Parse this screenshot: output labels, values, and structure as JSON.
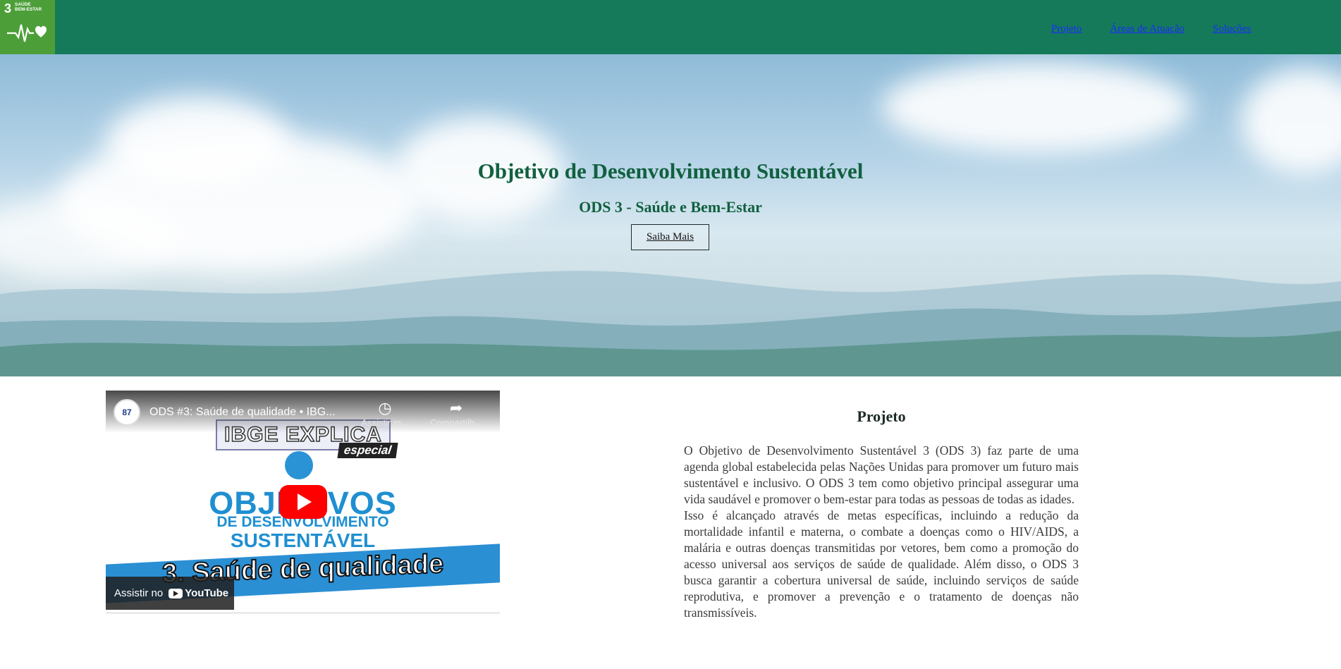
{
  "header": {
    "logo": {
      "number": "3",
      "label_line1": "SAÚDE",
      "label_line2": "BEM-ESTAR"
    },
    "nav": [
      "Projeto",
      "Áreas de Atuação",
      "Soluções"
    ]
  },
  "hero": {
    "title": "Objetivo de Desenvolvimento Sustentável",
    "subtitle": "ODS 3 - Saúde e Bem-Estar",
    "button_label": "Saiba Mais"
  },
  "video": {
    "channel_badge": "87",
    "title": "ODS #3: Saúde de qualidade • IBG...",
    "actions": [
      "Assistir m...",
      "Compartilh..."
    ],
    "thumb_banner": "IBGE EXPLICA",
    "thumb_tag": "especial",
    "thumb_line1": "OBJETIVOS",
    "thumb_line2": "DE DESENVOLVIMENTO",
    "thumb_line3": "SUSTENTÁVEL",
    "thumb_caption": "3. Saúde de qualidade",
    "watch_on": "Assistir no",
    "youtube": "YouTube"
  },
  "projeto": {
    "title": "Projeto",
    "paragraph1": "O Objetivo de Desenvolvimento Sustentável 3 (ODS 3) faz parte de uma agenda global estabelecida pelas Nações Unidas para promover um futuro mais sustentável e inclusivo. O ODS 3 tem como objetivo principal assegurar uma vida saudável e promover o bem-estar para todas as pessoas de todas as idades.",
    "paragraph2": "Isso é alcançado através de metas específicas, incluindo a redução da mortalidade infantil e materna, o combate a doenças como o HIV/AIDS, a malária e outras doenças transmitidas por vetores, bem como a promoção do acesso universal aos serviços de saúde de qualidade. Além disso, o ODS 3 busca garantir a cobertura universal de saúde, incluindo serviços de saúde reprodutiva, e promover a prevenção e o tratamento de doenças não transmissíveis."
  }
}
